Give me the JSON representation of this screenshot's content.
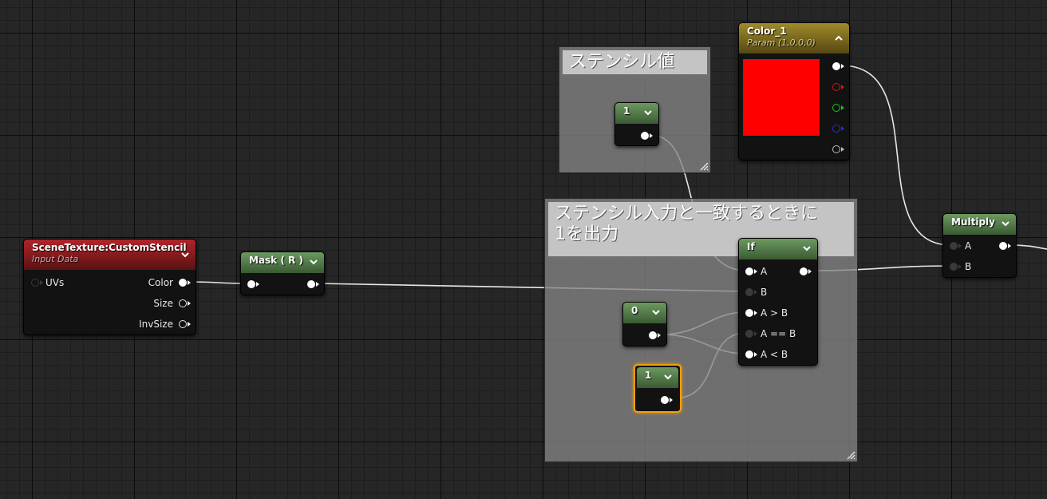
{
  "comments": {
    "stencil_value_title": "ステンシル値",
    "if_comment_title": "ステンシル入力と一致するときに\n1を出力"
  },
  "nodes": {
    "scene_texture": {
      "title": "SceneTexture:CustomStencil",
      "subtitle": "Input Data",
      "inputs": [
        "UVs"
      ],
      "outputs": [
        "Color",
        "Size",
        "InvSize"
      ]
    },
    "mask": {
      "title": "Mask ( R )"
    },
    "stencil_const": {
      "value": "1"
    },
    "const_zero": {
      "value": "0"
    },
    "const_one": {
      "value": "1"
    },
    "if_node": {
      "title": "If",
      "inputs": [
        "A",
        "B",
        "A > B",
        "A == B",
        "A < B"
      ]
    },
    "color_param": {
      "title": "Color_1",
      "subtitle": "Param (1,0,0,0)",
      "swatch_color": "#ff0000"
    },
    "multiply": {
      "title": "Multiply",
      "inputs": [
        "A",
        "B"
      ]
    }
  },
  "colors": {
    "accent_selected": "#f1a00b",
    "pin_red": "#e01010",
    "pin_green": "#20c020",
    "pin_blue": "#2030e0"
  }
}
